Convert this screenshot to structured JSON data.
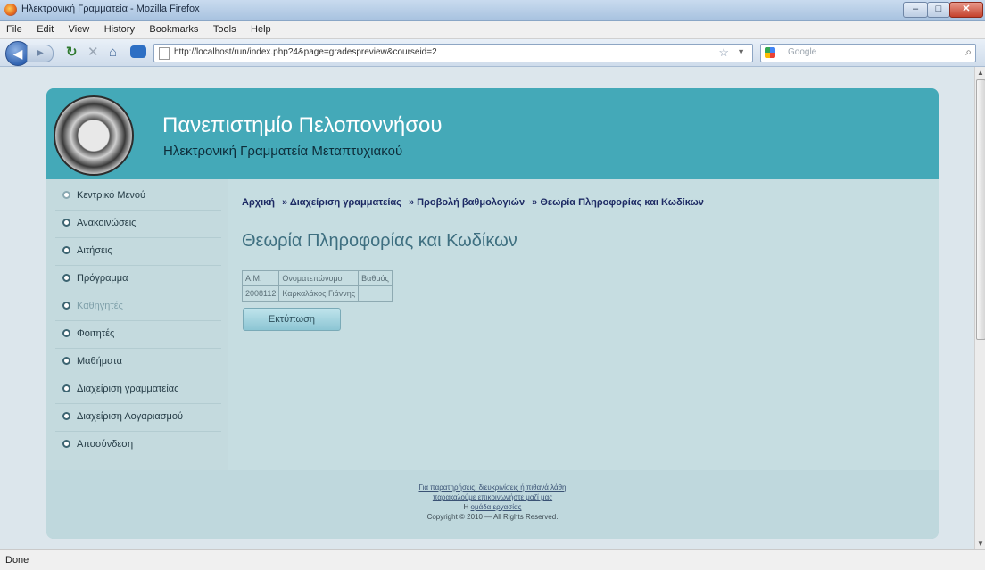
{
  "window": {
    "title": "Ηλεκτρονική Γραμματεία - Mozilla Firefox"
  },
  "menu": [
    "File",
    "Edit",
    "View",
    "History",
    "Bookmarks",
    "Tools",
    "Help"
  ],
  "nav": {
    "url": "http://localhost/run/index.php?4&page=gradespreview&courseid=2",
    "search_placeholder": "Google"
  },
  "site": {
    "title": "Πανεπιστημίο Πελοποννήσου",
    "subtitle": "Ηλεκτρονική Γραμματεία Μεταπτυχιακού"
  },
  "sidebar": {
    "items": [
      {
        "label": "Κεντρικό Μενού"
      },
      {
        "label": "Ανακοινώσεις"
      },
      {
        "label": "Αιτήσεις"
      },
      {
        "label": "Πρόγραμμα"
      },
      {
        "label": "Καθηγητές"
      },
      {
        "label": "Φοιτητές"
      },
      {
        "label": "Μαθήματα"
      },
      {
        "label": "Διαχείριση γραμματείας"
      },
      {
        "label": "Διαχείριση Λογαριασμού"
      },
      {
        "label": "Αποσύνδεση"
      }
    ]
  },
  "breadcrumb": [
    "Αρχική",
    "» Διαχείριση γραμματείας",
    "» Προβολή βαθμολογιών",
    "» Θεωρία Πληροφορίας και Κωδίκων"
  ],
  "main": {
    "title": "Θεωρία Πληροφορίας και Κωδίκων",
    "table": {
      "headers": [
        "Α.Μ.",
        "Ονοματεπώνυμο",
        "Βαθμός"
      ],
      "rows": [
        [
          "2008112",
          "Καρκαλάκος Γιάννης",
          ""
        ]
      ]
    },
    "print_label": "Εκτύπωση"
  },
  "footer": {
    "line1": "Για παρατηρήσεις, διευκρινίσεις ή πιθανά λάθη",
    "line2": "παρακαλούμε επικοινωνήστε μαζί μας",
    "line3_prefix": "Η ",
    "line3_link": "ομάδα εργασίας",
    "copyright": "Copyright © 2010 — All Rights Reserved."
  },
  "status": "Done"
}
